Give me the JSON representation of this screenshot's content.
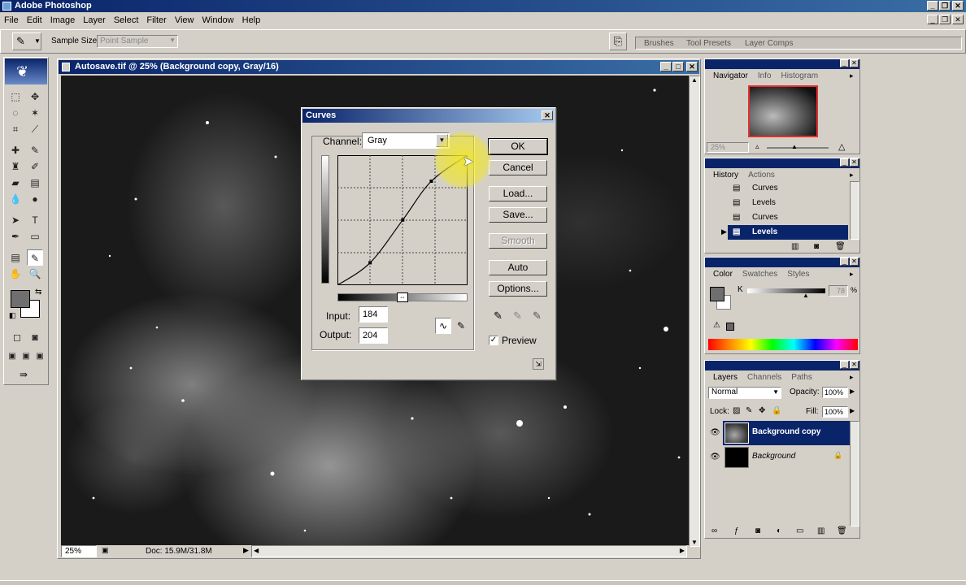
{
  "app": {
    "title": "Adobe Photoshop"
  },
  "menu": [
    "File",
    "Edit",
    "Image",
    "Layer",
    "Select",
    "Filter",
    "View",
    "Window",
    "Help"
  ],
  "options_bar": {
    "sample_size_label": "Sample Size:",
    "sample_size_value": "Point Sample",
    "palette_tabs": [
      "Brushes",
      "Tool Presets",
      "Layer Comps"
    ]
  },
  "document": {
    "title": "Autosave.tif @ 25% (Background copy, Gray/16)",
    "zoom": "25%",
    "doc_info": "Doc: 15.9M/31.8M"
  },
  "curves": {
    "title": "Curves",
    "channel_label": "Channel:",
    "channel_value": "Gray",
    "input_label": "Input:",
    "input_value": "184",
    "output_label": "Output:",
    "output_value": "204",
    "buttons": {
      "ok": "OK",
      "cancel": "Cancel",
      "load": "Load...",
      "save": "Save...",
      "smooth": "Smooth",
      "auto": "Auto",
      "options": "Options..."
    },
    "preview_label": "Preview",
    "preview_checked": true,
    "points": [
      [
        0,
        0
      ],
      [
        64,
        44
      ],
      [
        128,
        128
      ],
      [
        184,
        204
      ],
      [
        255,
        255
      ]
    ]
  },
  "navigator": {
    "tabs": [
      "Navigator",
      "Info",
      "Histogram"
    ],
    "zoom": "25%"
  },
  "history": {
    "tabs": [
      "History",
      "Actions"
    ],
    "items": [
      "Curves",
      "Levels",
      "Curves",
      "Levels"
    ]
  },
  "color": {
    "tabs": [
      "Color",
      "Swatches",
      "Styles"
    ],
    "channel": "K",
    "value": "78",
    "unit": "%"
  },
  "layers": {
    "tabs": [
      "Layers",
      "Channels",
      "Paths"
    ],
    "blend_mode": "Normal",
    "opacity_label": "Opacity:",
    "opacity": "100%",
    "lock_label": "Lock:",
    "fill_label": "Fill:",
    "fill": "100%",
    "items": [
      "Background copy",
      "Background"
    ]
  }
}
